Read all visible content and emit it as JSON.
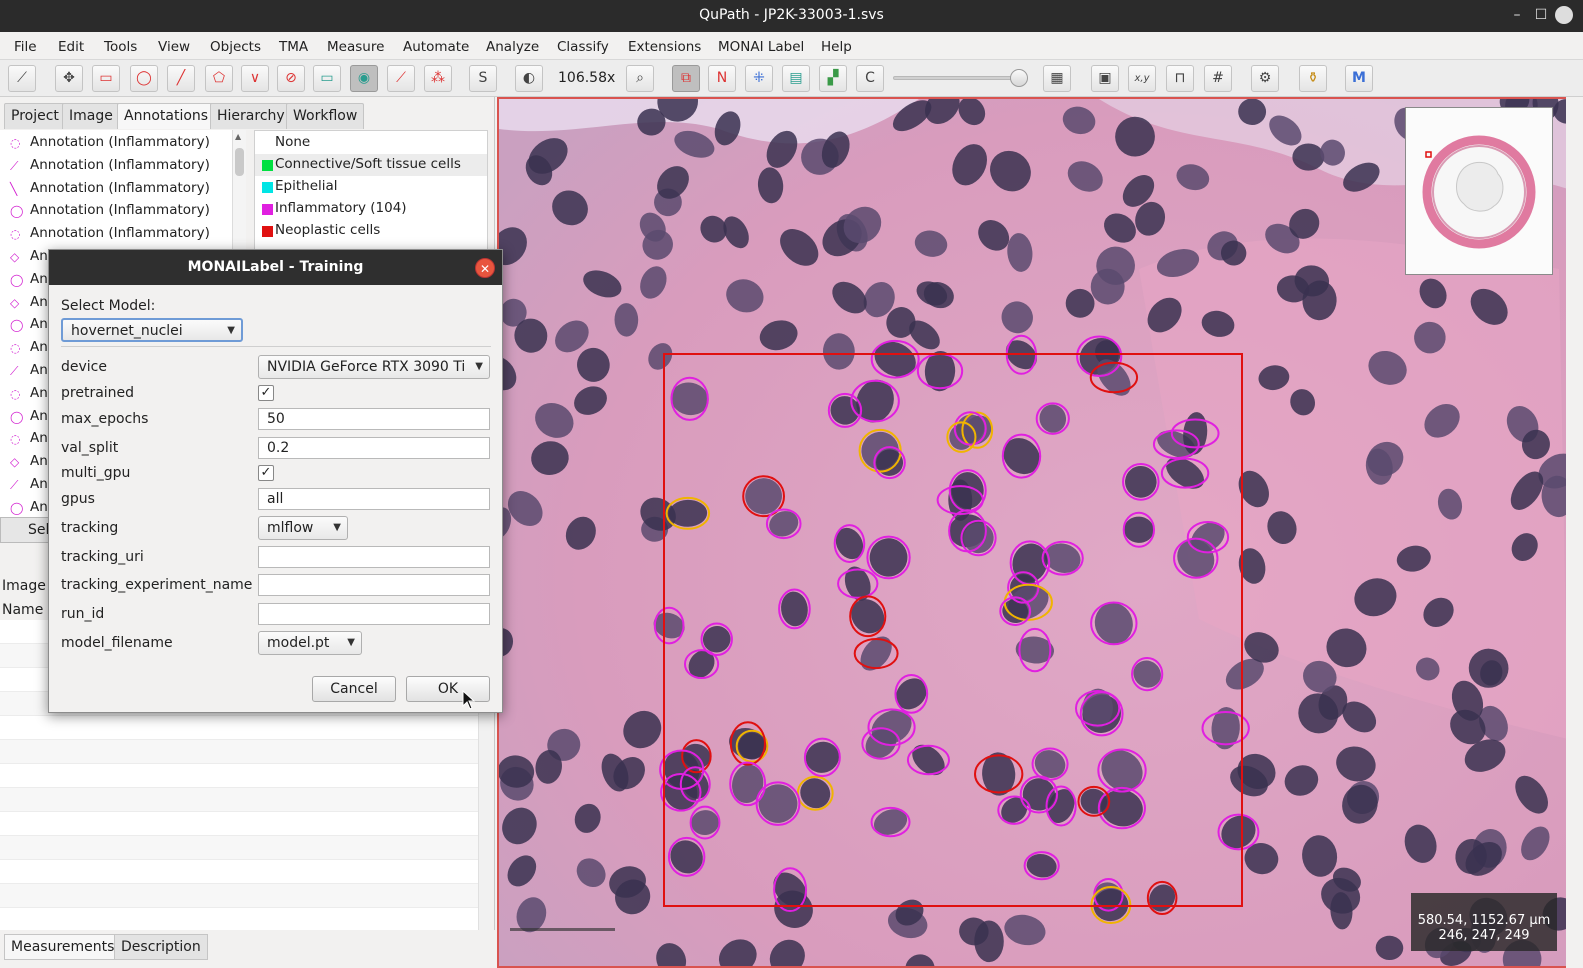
{
  "window": {
    "title": "QuPath - JP2K-33003-1.svs"
  },
  "menu": [
    "File",
    "Edit",
    "Tools",
    "View",
    "Objects",
    "TMA",
    "Measure",
    "Automate",
    "Analyze",
    "Classify",
    "Extensions",
    "MONAI Label",
    "Help"
  ],
  "toolbar": {
    "zoom": "106.58x",
    "text_buttons": {
      "s": "S",
      "n": "N",
      "c": "C",
      "xy": "x,y"
    }
  },
  "left_tabs": [
    "Project",
    "Image",
    "Annotations",
    "Hierarchy",
    "Workflow"
  ],
  "annotations": [
    "Annotation (Inflammatory)",
    "Annotation (Inflammatory)",
    "Annotation (Inflammatory)",
    "Annotation (Inflammatory)",
    "Annotation (Inflammatory)",
    "Ann",
    "Ann",
    "Ann",
    "Ann",
    "Ann",
    "Ann",
    "Ann",
    "Ann",
    "Ann",
    "Ann",
    "Ann",
    "Ann"
  ],
  "classes": [
    {
      "name": "None",
      "color": ""
    },
    {
      "name": "Connective/Soft tissue cells",
      "color": "#00e040"
    },
    {
      "name": "Epithelial",
      "color": "#00e5e5"
    },
    {
      "name": "Inflammatory (104)",
      "color": "#e020e0"
    },
    {
      "name": "Neoplastic cells",
      "color": "#e01010"
    }
  ],
  "left_lower": {
    "select_button": "Sel",
    "image_label": "Image",
    "name_label": "Name"
  },
  "bottom_tabs": [
    "Measurements",
    "Description"
  ],
  "viewer": {
    "coords_line1": "580.54, 1152.67 µm",
    "coords_line2": "246, 247, 249"
  },
  "dialog": {
    "title": "MONAILabel - Training",
    "select_model_label": "Select Model:",
    "model": "hovernet_nuclei",
    "params": {
      "device": {
        "label": "device",
        "value": "NVIDIA GeForce RTX 3090 Ti"
      },
      "pretrained": {
        "label": "pretrained",
        "checked": true
      },
      "max_epochs": {
        "label": "max_epochs",
        "value": "50"
      },
      "val_split": {
        "label": "val_split",
        "value": "0.2"
      },
      "multi_gpu": {
        "label": "multi_gpu",
        "checked": true
      },
      "gpus": {
        "label": "gpus",
        "value": "all"
      },
      "tracking": {
        "label": "tracking",
        "value": "mlflow"
      },
      "tracking_uri": {
        "label": "tracking_uri",
        "value": ""
      },
      "tracking_experiment_name": {
        "label": "tracking_experiment_name",
        "value": ""
      },
      "run_id": {
        "label": "run_id",
        "value": ""
      },
      "model_filename": {
        "label": "model_filename",
        "value": "model.pt"
      }
    },
    "cancel": "Cancel",
    "ok": "OK"
  },
  "colors": {
    "annotation_magenta": "#e020e0",
    "annotation_red": "#e01010",
    "annotation_yellow": "#f0b400",
    "selection_box": "#e01010"
  }
}
